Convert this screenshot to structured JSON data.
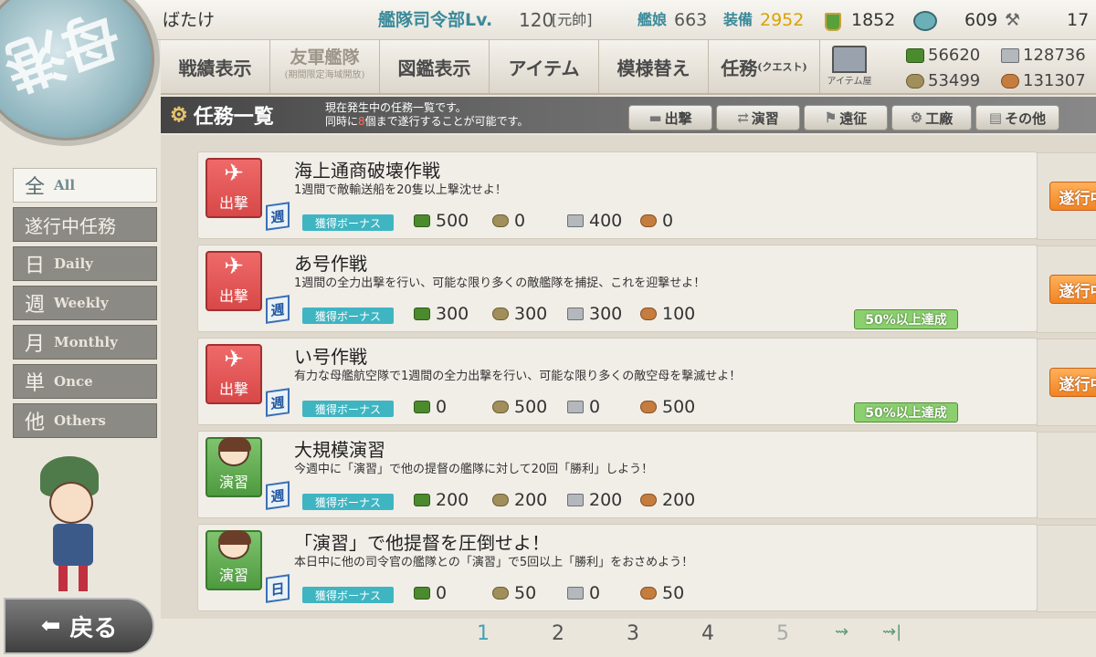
{
  "player": {
    "name": "ばたけ",
    "hq": "艦隊司令部Lv.",
    "level": "120",
    "rank": "[元帥]",
    "ships_label": "艦娘",
    "ships": "663",
    "equip_label": "装備",
    "equip": "2952",
    "buckets": "1852",
    "dev": "609",
    "screws": "17"
  },
  "nav": {
    "items": [
      {
        "label": "戦績表示",
        "dim": false
      },
      {
        "label": "友軍艦隊",
        "sub": "(期間限定海域開放)",
        "dim": true
      },
      {
        "label": "図鑑表示",
        "dim": false
      },
      {
        "label": "アイテム",
        "dim": false
      },
      {
        "label": "模様替え",
        "dim": false
      },
      {
        "label": "任務",
        "sub": "(クエスト)",
        "dim": false
      }
    ],
    "shop_label": "アイテム屋"
  },
  "resources": {
    "fuel": "56620",
    "steel": "128736",
    "ammo": "53499",
    "bauxite": "131307"
  },
  "header": {
    "title": "任務一覧",
    "desc1": "現在発生中の任務一覧です。",
    "desc2_pre": "同時に",
    "desc2_num": "8",
    "desc2_post": "個まで遂行することが可能です。"
  },
  "categories": [
    "出撃",
    "演習",
    "遠征",
    "工廠",
    "その他"
  ],
  "sidebar": [
    {
      "kanji": "全",
      "label": "All",
      "active": true
    },
    {
      "kanji": "遂行中任務",
      "label": "",
      "active": false
    },
    {
      "kanji": "日",
      "label": "Daily",
      "active": false
    },
    {
      "kanji": "週",
      "label": "Weekly",
      "active": false
    },
    {
      "kanji": "月",
      "label": "Monthly",
      "active": false
    },
    {
      "kanji": "単",
      "label": "Once",
      "active": false
    },
    {
      "kanji": "他",
      "label": "Others",
      "active": false
    }
  ],
  "quests": [
    {
      "title": "海上通商破壊作戦",
      "desc": "1週間で敵輸送船を20隻以上撃沈せよ！",
      "type": "出撃",
      "freq": "週",
      "bonus": "獲得ボーナス",
      "rewards": [
        "500",
        "0",
        "400",
        "0"
      ],
      "progress": "",
      "status": "遂行中"
    },
    {
      "title": "あ号作戦",
      "desc": "1週間の全力出撃を行い、可能な限り多くの敵艦隊を捕捉、これを迎撃せよ！",
      "type": "出撃",
      "freq": "週",
      "bonus": "獲得ボーナス",
      "rewards": [
        "300",
        "300",
        "300",
        "100"
      ],
      "progress": "50%以上達成",
      "status": "遂行中"
    },
    {
      "title": "い号作戦",
      "desc": "有力な母艦航空隊で1週間の全力出撃を行い、可能な限り多くの敵空母を撃滅せよ！",
      "type": "出撃",
      "freq": "週",
      "bonus": "獲得ボーナス",
      "rewards": [
        "0",
        "500",
        "0",
        "500"
      ],
      "progress": "50%以上達成",
      "status": "遂行中"
    },
    {
      "title": "大規模演習",
      "desc": "今週中に「演習」で他の提督の艦隊に対して20回「勝利」しよう！",
      "type": "演習",
      "freq": "週",
      "bonus": "獲得ボーナス",
      "rewards": [
        "200",
        "200",
        "200",
        "200"
      ],
      "progress": "",
      "status": ""
    },
    {
      "title": "「演習」で他提督を圧倒せよ！",
      "desc": "本日中に他の司令官の艦隊との「演習」で5回以上「勝利」をおさめよう！",
      "type": "演習",
      "freq": "日",
      "bonus": "獲得ボーナス",
      "rewards": [
        "0",
        "50",
        "0",
        "50"
      ],
      "progress": "",
      "status": ""
    }
  ],
  "pager": {
    "pages": [
      "1",
      "2",
      "3",
      "4",
      "5"
    ],
    "current": "1"
  },
  "back_label": "戻る",
  "colors": {
    "sortie": "#d84848",
    "exercise": "#4e9a3f",
    "in_progress": "#f08424",
    "accent": "#46a1b6"
  }
}
